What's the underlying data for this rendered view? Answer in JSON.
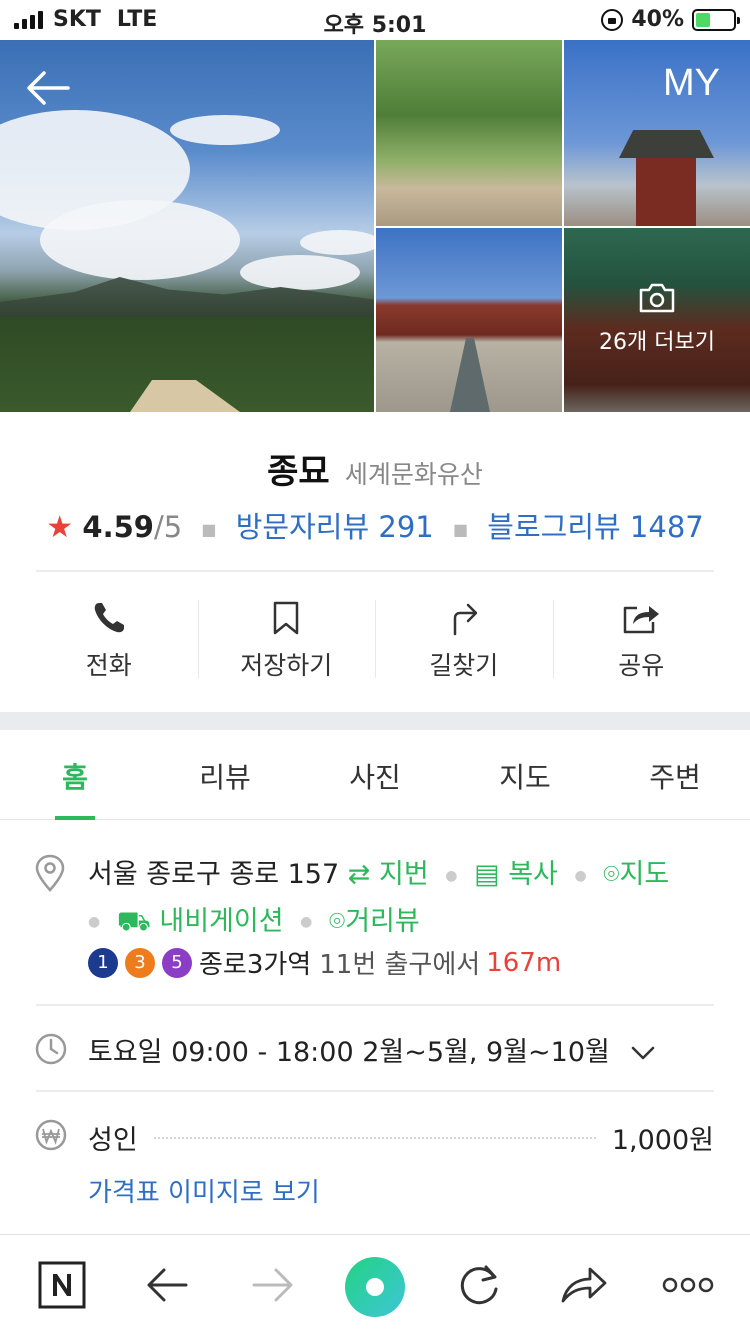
{
  "status_bar": {
    "carrier": "SKT",
    "network": "LTE",
    "time": "오후 5:01",
    "battery": "40%"
  },
  "photos": {
    "top_right_button": "MY",
    "more_label": "26개 더보기"
  },
  "place": {
    "name": "종묘",
    "category": "세계문화유산",
    "rating": "4.59",
    "rating_max": "/5",
    "visitor_reviews": "방문자리뷰 291",
    "blog_reviews": "블로그리뷰 1487"
  },
  "actions": [
    {
      "label": "전화",
      "icon": "phone-icon"
    },
    {
      "label": "저장하기",
      "icon": "bookmark-icon"
    },
    {
      "label": "길찾기",
      "icon": "directions-icon"
    },
    {
      "label": "공유",
      "icon": "share-icon"
    }
  ],
  "tabs": [
    {
      "label": "홈",
      "active": true
    },
    {
      "label": "리뷰"
    },
    {
      "label": "사진"
    },
    {
      "label": "지도"
    },
    {
      "label": "주변"
    }
  ],
  "address": {
    "text": "서울 종로구 종로 157",
    "jibeon": "지번",
    "copy": "복사",
    "map": "지도",
    "navigation": "내비게이션",
    "streetview": "거리뷰"
  },
  "subway": {
    "lines": [
      {
        "num": "1",
        "color": "#1c3a8e"
      },
      {
        "num": "3",
        "color": "#ef7c1c"
      },
      {
        "num": "5",
        "color": "#8b3dc6"
      }
    ],
    "station": "종로3가역",
    "exit": "11번 출구에서",
    "distance": "167m"
  },
  "hours": {
    "text": "토요일 09:00 - 18:00 2월~5월, 9월~10월"
  },
  "price": {
    "label": "성인",
    "value": "1,000원",
    "link": "가격표 이미지로 보기"
  },
  "colors": {
    "green": "#2db85c",
    "blue": "#2e6fc4",
    "red": "#e8423a"
  }
}
